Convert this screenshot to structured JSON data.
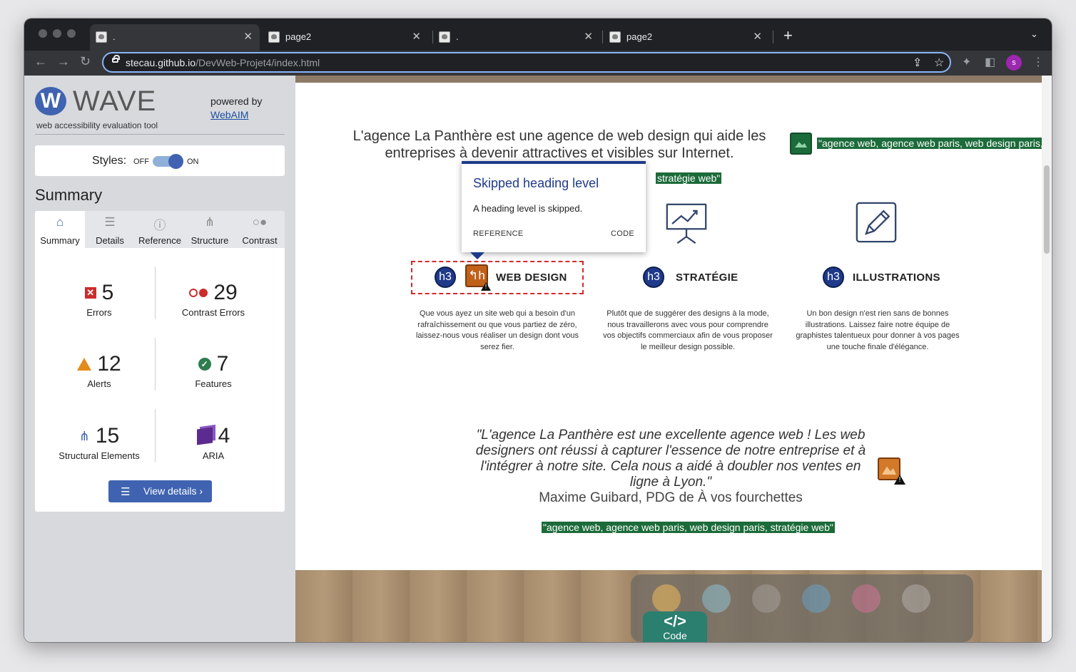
{
  "browser": {
    "tabs": [
      {
        "label": ".",
        "active": true
      },
      {
        "label": "page2",
        "active": false
      },
      {
        "label": ".",
        "active": false
      },
      {
        "label": "page2",
        "active": false
      }
    ],
    "url_host": "stecau.github.io",
    "url_path": "/DevWeb-Projet4/index.html",
    "profile_initial": "s"
  },
  "wave": {
    "title": "WAVE",
    "subtitle": "web accessibility evaluation tool",
    "powered_by": "powered by",
    "webaim_link": "WebAIM",
    "styles_label": "Styles:",
    "styles_off": "OFF",
    "styles_on": "ON",
    "styles_enabled": true,
    "summary_heading": "Summary",
    "tabs": [
      {
        "label": "Summary",
        "icon": "home-icon"
      },
      {
        "label": "Details",
        "icon": "list-icon"
      },
      {
        "label": "Reference",
        "icon": "info-icon"
      },
      {
        "label": "Structure",
        "icon": "structure-icon"
      },
      {
        "label": "Contrast",
        "icon": "contrast-icon"
      }
    ],
    "stats": {
      "errors": {
        "count": "5",
        "label": "Errors"
      },
      "contrast": {
        "count": "29",
        "label": "Contrast Errors"
      },
      "alerts": {
        "count": "12",
        "label": "Alerts"
      },
      "features": {
        "count": "7",
        "label": "Features"
      },
      "structural": {
        "count": "15",
        "label": "Structural Elements"
      },
      "aria": {
        "count": "4",
        "label": "ARIA"
      }
    },
    "view_details": "View details ›",
    "colors": {
      "accent": "#3f63b0",
      "error": "#cb2c2c",
      "alert": "#e38c1b",
      "feature": "#2e7d4f"
    }
  },
  "page": {
    "intro": "L'agence La Panthère est une agence de web design qui aide les entreprises à devenir attractives et visibles sur Internet.",
    "alt_top": "\"agence web, agence web paris, web design paris,",
    "alt_top2": "stratégie web\"",
    "popup": {
      "title": "Skipped heading level",
      "text": "A heading level is skipped.",
      "reference": "REFERENCE",
      "code": "CODE"
    },
    "h3_badge": "h3",
    "services": [
      {
        "title": "WEB DESIGN",
        "desc": "Que vous ayez un site web qui a besoin d'un rafraîchissement ou que vous partiez de zéro, laissez-nous vous réaliser un design dont vous serez fier."
      },
      {
        "title": "STRATÉGIE",
        "desc": "Plutôt que de suggérer des designs à la mode, nous travaillerons avec vous pour comprendre vos objectifs commerciaux afin de vous proposer le meilleur design possible."
      },
      {
        "title": "ILLUSTRATIONS",
        "desc": "Un bon design n'est rien sans de bonnes illustrations. Laissez faire notre équipe de graphistes talentueux pour donner à vos pages une touche finale d'élégance."
      }
    ],
    "quote": "\"L'agence La Panthère est une excellente agence web ! Les web designers ont réussi à capturer l'essence de notre entreprise et à l'intégrer à notre site. Cela nous a aidé à doubler nos ventes en ligne à Lyon.\"",
    "quote_author": "Maxime Guibard, PDG de À vos fourchettes",
    "alt_bottom": "\"agence web, agence web paris, web design paris, stratégie web\"",
    "code_button": "Code"
  }
}
